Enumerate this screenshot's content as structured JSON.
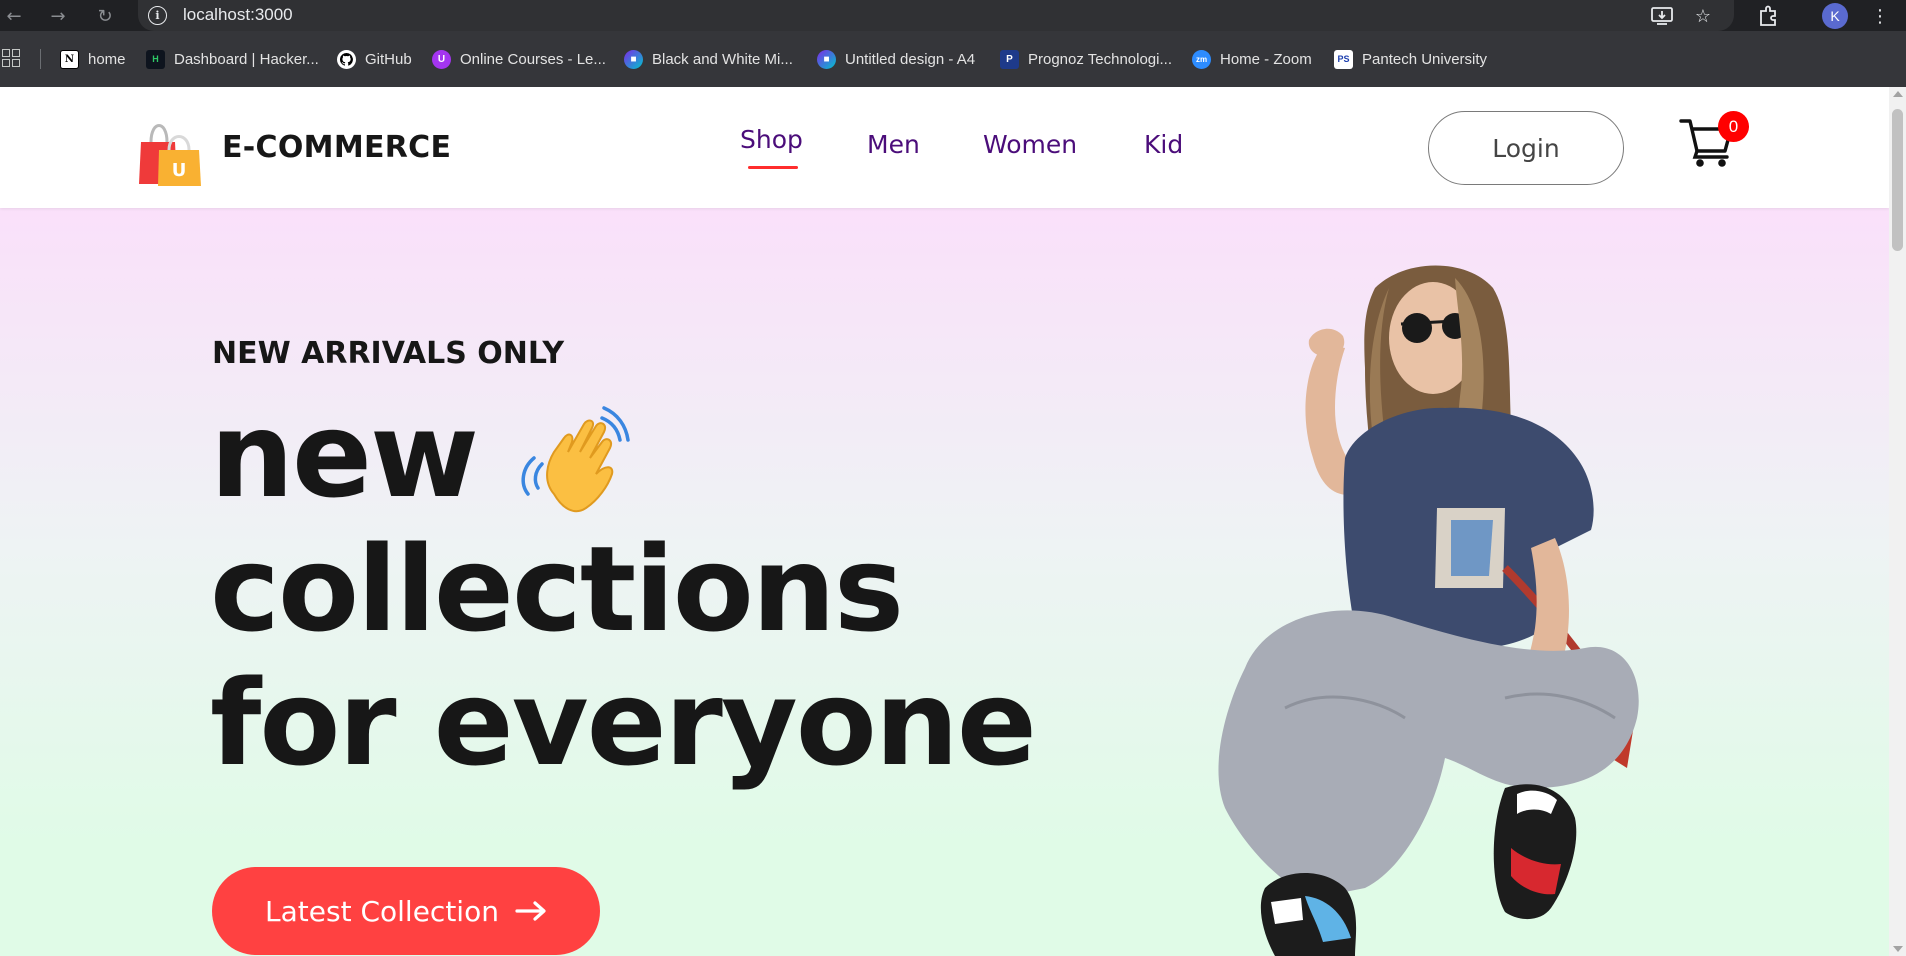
{
  "browser": {
    "url": "localhost:3000",
    "profile_initial": "K",
    "bookmarks": [
      {
        "label": "home",
        "icon": "notion-icon"
      },
      {
        "label": "Dashboard | Hacker...",
        "icon": "hackerrank-icon"
      },
      {
        "label": "GitHub",
        "icon": "github-icon"
      },
      {
        "label": "Online Courses - Le...",
        "icon": "udemy-icon"
      },
      {
        "label": "Black and White Mi...",
        "icon": "canva-icon"
      },
      {
        "label": "Untitled design - A4",
        "icon": "canva-icon"
      },
      {
        "label": "Prognoz Technologi...",
        "icon": "prognoz-icon"
      },
      {
        "label": "Home - Zoom",
        "icon": "zoom-icon"
      },
      {
        "label": "Pantech University",
        "icon": "pantech-icon"
      }
    ]
  },
  "navbar": {
    "brand": "E-COMMERCE",
    "brand_badge": "U",
    "menu": [
      "Shop",
      "Men",
      "Women",
      "Kid"
    ],
    "active_menu": "Shop",
    "login_label": "Login",
    "cart_count": "0"
  },
  "hero": {
    "eyebrow": "NEW ARRIVALS ONLY",
    "line1": "new",
    "line2": "collections",
    "line3": "for everyone",
    "cta_label": "Latest Collection"
  },
  "colors": {
    "accent_red": "#ff4141",
    "menu_purple": "#4b0d7a",
    "badge_red": "#ff0000",
    "hero_top": "#fae0fa",
    "hero_bottom": "#e0fbe7"
  }
}
